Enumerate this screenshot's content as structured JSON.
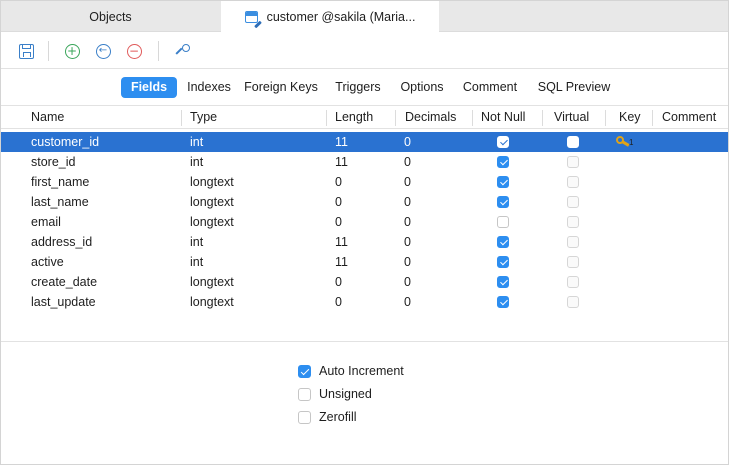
{
  "tabs": [
    {
      "label": "Objects",
      "active": false
    },
    {
      "label": "customer @sakila (Maria...",
      "active": true,
      "icon": "table-edit-icon"
    }
  ],
  "toolbar": {
    "icons": [
      "save-icon",
      "add-field-icon",
      "insert-field-icon",
      "delete-field-icon",
      "primary-key-icon"
    ],
    "colors": {
      "accent": "#2d8ef0",
      "add": "#3aa55a",
      "delete": "#e05a5a"
    }
  },
  "segments": [
    {
      "label": "Fields",
      "active": true
    },
    {
      "label": "Indexes",
      "active": false
    },
    {
      "label": "Foreign Keys",
      "active": false
    },
    {
      "label": "Triggers",
      "active": false
    },
    {
      "label": "Options",
      "active": false
    },
    {
      "label": "Comment",
      "active": false
    },
    {
      "label": "SQL Preview",
      "active": false
    }
  ],
  "grid": {
    "columns": [
      "Name",
      "Type",
      "Length",
      "Decimals",
      "Not Null",
      "Virtual",
      "Key",
      "Comment"
    ],
    "selected_row_color": "#2a72d1",
    "rows": [
      {
        "name": "customer_id",
        "type": "int",
        "length": "11",
        "decimals": "0",
        "not_null": true,
        "virtual": false,
        "key": "1",
        "comment": "",
        "selected": true
      },
      {
        "name": "store_id",
        "type": "int",
        "length": "11",
        "decimals": "0",
        "not_null": true,
        "virtual": false,
        "key": "",
        "comment": "",
        "selected": false
      },
      {
        "name": "first_name",
        "type": "longtext",
        "length": "0",
        "decimals": "0",
        "not_null": true,
        "virtual": false,
        "key": "",
        "comment": "",
        "selected": false
      },
      {
        "name": "last_name",
        "type": "longtext",
        "length": "0",
        "decimals": "0",
        "not_null": true,
        "virtual": false,
        "key": "",
        "comment": "",
        "selected": false
      },
      {
        "name": "email",
        "type": "longtext",
        "length": "0",
        "decimals": "0",
        "not_null": false,
        "virtual": false,
        "key": "",
        "comment": "",
        "selected": false
      },
      {
        "name": "address_id",
        "type": "int",
        "length": "11",
        "decimals": "0",
        "not_null": true,
        "virtual": false,
        "key": "",
        "comment": "",
        "selected": false
      },
      {
        "name": "active",
        "type": "int",
        "length": "11",
        "decimals": "0",
        "not_null": true,
        "virtual": false,
        "key": "",
        "comment": "",
        "selected": false
      },
      {
        "name": "create_date",
        "type": "longtext",
        "length": "0",
        "decimals": "0",
        "not_null": true,
        "virtual": false,
        "key": "",
        "comment": "",
        "selected": false
      },
      {
        "name": "last_update",
        "type": "longtext",
        "length": "0",
        "decimals": "0",
        "not_null": true,
        "virtual": false,
        "key": "",
        "comment": "",
        "selected": false
      }
    ]
  },
  "field_options": [
    {
      "label": "Auto Increment",
      "checked": true
    },
    {
      "label": "Unsigned",
      "checked": false
    },
    {
      "label": "Zerofill",
      "checked": false
    }
  ]
}
